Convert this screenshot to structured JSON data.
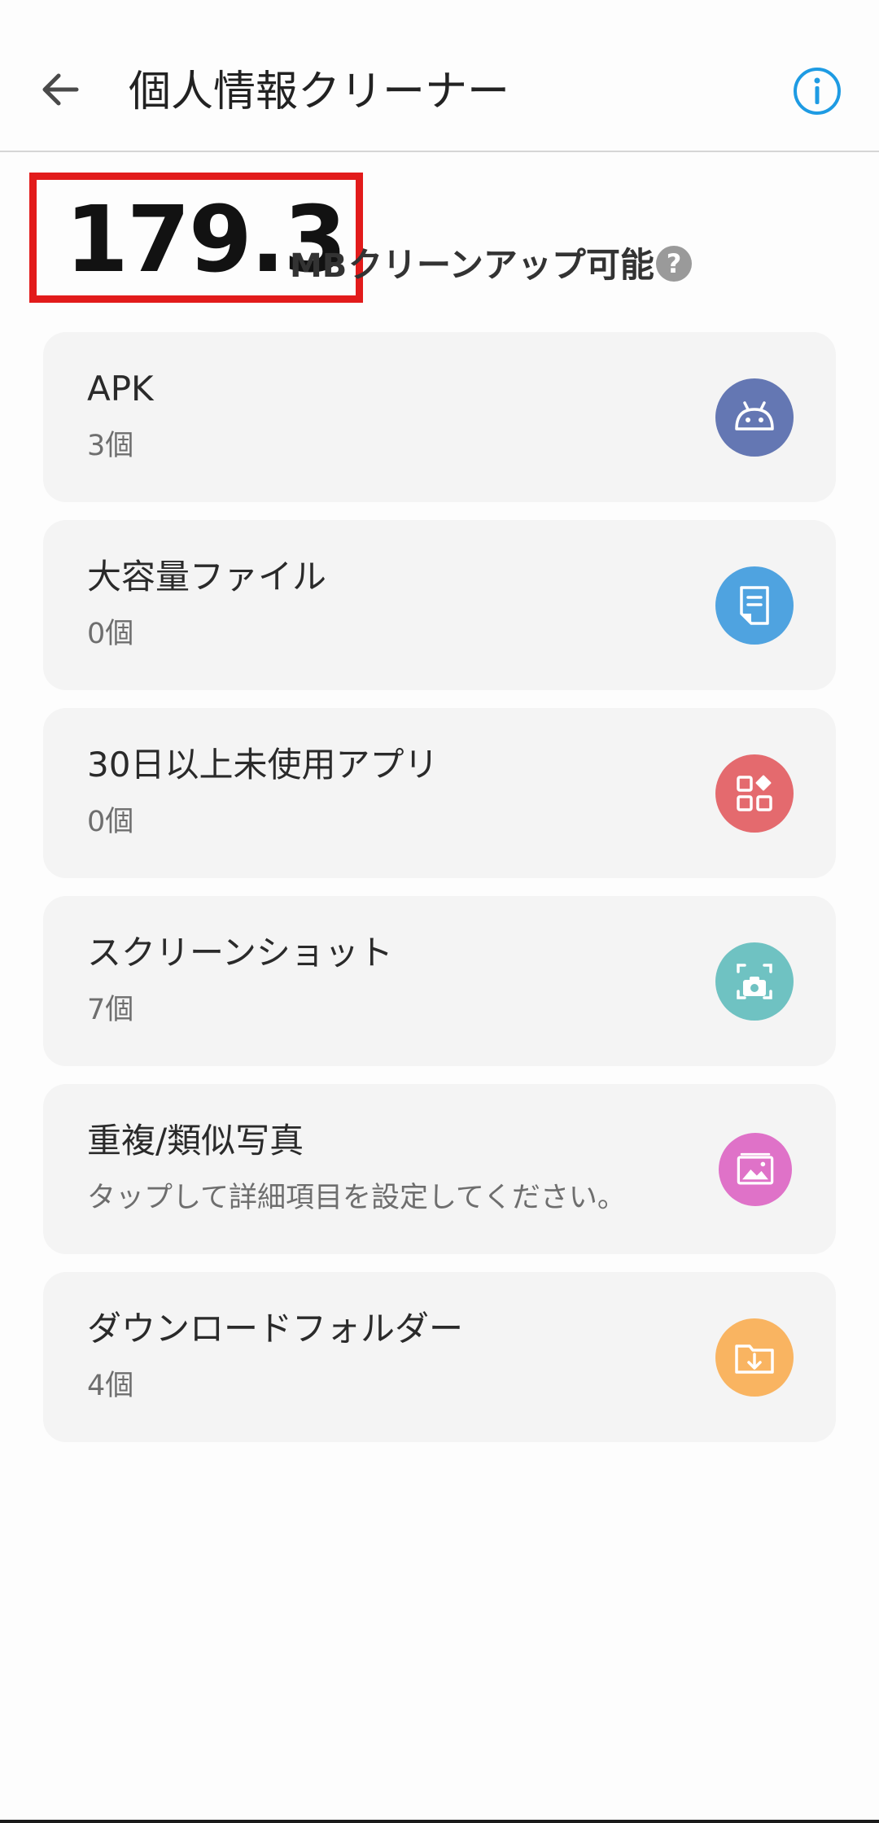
{
  "header": {
    "title": "個人情報クリーナー",
    "back_icon": "arrow-left-icon",
    "info_icon": "info-icon"
  },
  "summary": {
    "size_value": "179.3",
    "size_unit": "MB",
    "label": "クリーンアップ可能",
    "help_symbol": "?"
  },
  "categories": [
    {
      "title": "APK",
      "subtitle": "3個",
      "icon": "android-icon",
      "color": "#6477b3"
    },
    {
      "title": "大容量ファイル",
      "subtitle": "0個",
      "icon": "document-icon",
      "color": "#4fa3e0"
    },
    {
      "title": "30日以上未使用アプリ",
      "subtitle": "0個",
      "icon": "apps-grid-icon",
      "color": "#e46a6e"
    },
    {
      "title": "スクリーンショット",
      "subtitle": "7個",
      "icon": "screenshot-camera-icon",
      "color": "#6fc2c2"
    },
    {
      "title": "重複/類似写真",
      "subtitle": "タップして詳細項目を設定してください。",
      "icon": "photo-gallery-icon",
      "color": "#df72c8"
    },
    {
      "title": "ダウンロードフォルダー",
      "subtitle": "4個",
      "icon": "download-folder-icon",
      "color": "#f9b461"
    }
  ],
  "colors": {
    "highlight_border": "#e21b1b",
    "info_accent": "#1e9be3",
    "card_background": "#f4f4f4"
  }
}
